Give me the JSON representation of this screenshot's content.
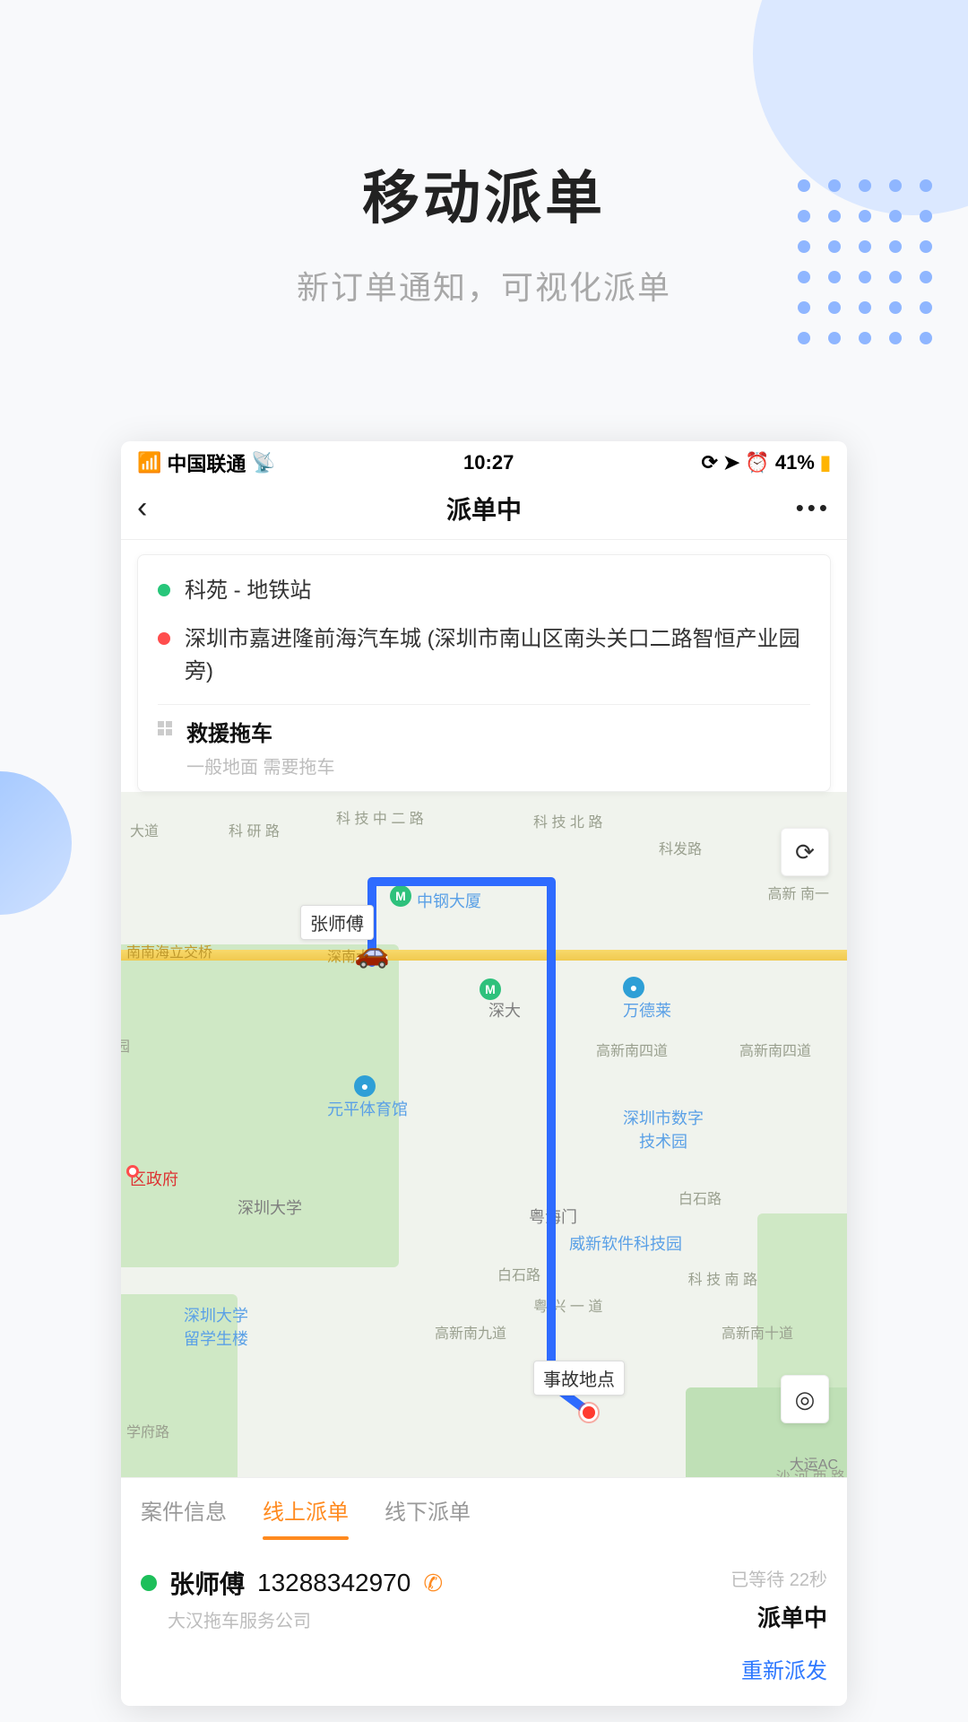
{
  "hero": {
    "title": "移动派单",
    "subtitle": "新订单通知，可视化派单"
  },
  "statusBar": {
    "carrier": "中国联通",
    "time": "10:27",
    "battery": "41%"
  },
  "nav": {
    "title": "派单中"
  },
  "infoCard": {
    "pickup": "科苑 - 地铁站",
    "destination": "深圳市嘉进隆前海汽车城 (深圳市南山区南头关口二路智恒产业园旁)",
    "serviceTitle": "救援拖车",
    "serviceSub": "一般地面 需要拖车"
  },
  "map": {
    "driverLabel": "张师傅",
    "accidentLabel": "事故地点",
    "pois": {
      "zhonggang": "中钢大厦",
      "shenda": "深大",
      "wandelai": "万德莱",
      "yuanping": "元平体育馆",
      "shuzi": "深圳市数字\n技术园",
      "weixin": "威新软件科技园",
      "shendaUniv": "深圳大学",
      "liuxue": "深圳大学\n留学生楼",
      "quGov": "区政府",
      "yuehai": "粤海门"
    },
    "roads": {
      "keyan": "科\n研\n路",
      "keji": "科\n技\n中\n二\n路",
      "kejibei": "科\n技\n北\n路",
      "kefa": "科发路",
      "gaoxinnan4": "高新南四道",
      "gaoxinnan9": "高新南九道",
      "gaoxinnan10": "高新南十道",
      "baishi1": "白石路",
      "baishi2": "白石路",
      "xuefu": "学府路",
      "shennan": "深南大道",
      "nannanhaili": "南南海立交桥",
      "yuexing1": "粤\n兴\n一\n道",
      "yuan": "园",
      "kejinan": "科\n技\n南\n路",
      "gaoxin1": "高新\n南一",
      "shahezx": "沙\n河\n西\n路",
      "dadao": "大道",
      "dayunAC": "大运AC"
    }
  },
  "tabs": {
    "info": "案件信息",
    "online": "线上派单",
    "offline": "线下派单"
  },
  "driver": {
    "name": "张师傅",
    "phone": "13288342970",
    "company": "大汉拖车服务公司",
    "wait": "已等待 22秒",
    "status": "派单中"
  },
  "actions": {
    "redispatch": "重新派发"
  }
}
